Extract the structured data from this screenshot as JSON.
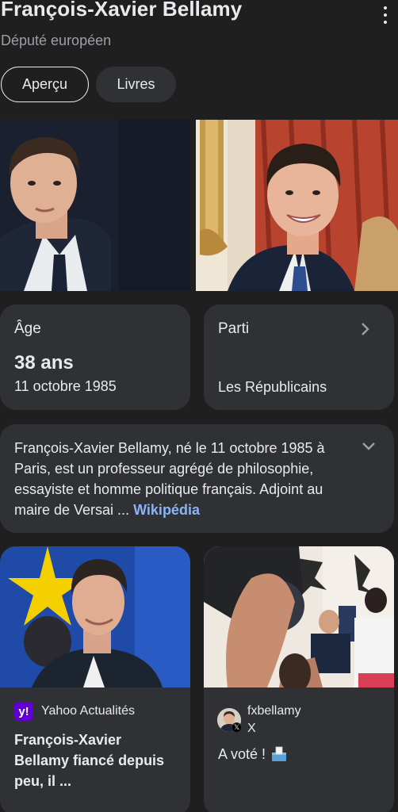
{
  "header": {
    "title": "François-Xavier Bellamy",
    "subtitle": "Député européen"
  },
  "tabs": [
    {
      "label": "Aperçu",
      "active": true
    },
    {
      "label": "Livres",
      "active": false
    }
  ],
  "facts": {
    "age": {
      "label": "Âge",
      "value": "38 ans",
      "detail": "11 octobre 1985"
    },
    "party": {
      "label": "Parti",
      "value": "Les Républicains"
    }
  },
  "description": {
    "text": "François-Xavier Bellamy, né le 11 octobre 1985 à Paris, est un professeur agrégé de philosophie, essayiste et homme politique français. Adjoint au maire de Versai ...",
    "source_link": "Wikipédia"
  },
  "news": {
    "source": "Yahoo Actualités",
    "logo_text": "y!",
    "title": "François-Xavier Bellamy fiancé depuis peu, il ..."
  },
  "social": {
    "handle": "fxbellamy",
    "platform": "X",
    "post_text": "A voté !",
    "badge_text": "𝕏"
  },
  "colors": {
    "background": "#1f1f1f",
    "card": "#303134",
    "link": "#8ab4f8",
    "muted": "#9aa0a6",
    "yahoo": "#6001d2"
  },
  "icons": [
    "more-vert-icon",
    "chevron-right-icon",
    "chevron-down-icon",
    "yahoo-logo-icon",
    "x-logo-icon",
    "ballot-box-icon"
  ]
}
